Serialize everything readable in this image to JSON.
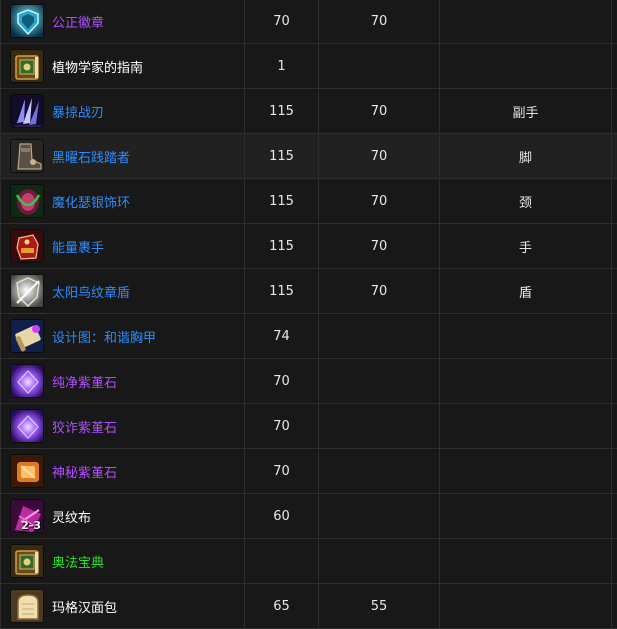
{
  "colors": {
    "epic": "#b14dff",
    "rare": "#2b8cff",
    "common": "#ffffff",
    "uncommon": "#2de02d"
  },
  "rows": [
    {
      "name": "公正徽章",
      "quality": "epic",
      "icon": "badge-of-justice-icon",
      "c1": "70",
      "c2": "70",
      "c3": "",
      "c4": ""
    },
    {
      "name": "植物学家的指南",
      "quality": "common",
      "icon": "book-icon",
      "c1": "1",
      "c2": "",
      "c3": "",
      "c4": ""
    },
    {
      "name": "暴掠战刃",
      "quality": "rare",
      "icon": "claw-blade-icon",
      "c1": "115",
      "c2": "70",
      "c3": "副手",
      "c4": ""
    },
    {
      "name": "黑曜石践踏者",
      "quality": "rare",
      "icon": "boots-icon",
      "c1": "115",
      "c2": "70",
      "c3": "脚",
      "c4": ""
    },
    {
      "name": "魔化瑟银饰环",
      "quality": "rare",
      "icon": "necklace-icon",
      "c1": "115",
      "c2": "70",
      "c3": "颈",
      "c4": ""
    },
    {
      "name": "能量裹手",
      "quality": "rare",
      "icon": "gauntlet-icon",
      "c1": "115",
      "c2": "70",
      "c3": "手",
      "c4": ""
    },
    {
      "name": "太阳鸟纹章盾",
      "quality": "rare",
      "icon": "shield-icon",
      "c1": "115",
      "c2": "70",
      "c3": "盾",
      "c4": ""
    },
    {
      "name": "设计图：和谐胸甲",
      "quality": "rare",
      "icon": "scroll-icon",
      "c1": "74",
      "c2": "",
      "c3": "",
      "c4": ""
    },
    {
      "name": "纯净紫堇石",
      "quality": "epic",
      "icon": "purple-gem-icon",
      "c1": "70",
      "c2": "",
      "c3": "",
      "c4": ""
    },
    {
      "name": "狡诈紫堇石",
      "quality": "epic",
      "icon": "purple-gem-icon",
      "c1": "70",
      "c2": "",
      "c3": "",
      "c4": ""
    },
    {
      "name": "神秘紫堇石",
      "quality": "epic",
      "icon": "orange-gem-icon",
      "c1": "70",
      "c2": "",
      "c3": "",
      "c4": ""
    },
    {
      "name": "灵纹布",
      "quality": "common",
      "icon": "cloth-icon",
      "stack": "2-3",
      "c1": "60",
      "c2": "",
      "c3": "",
      "c4": ""
    },
    {
      "name": "奥法宝典",
      "quality": "uncommon",
      "icon": "book-icon",
      "c1": "",
      "c2": "",
      "c3": "",
      "c4": ""
    },
    {
      "name": "玛格汉面包",
      "quality": "common",
      "icon": "bread-icon",
      "c1": "65",
      "c2": "55",
      "c3": "",
      "c4": ""
    }
  ]
}
